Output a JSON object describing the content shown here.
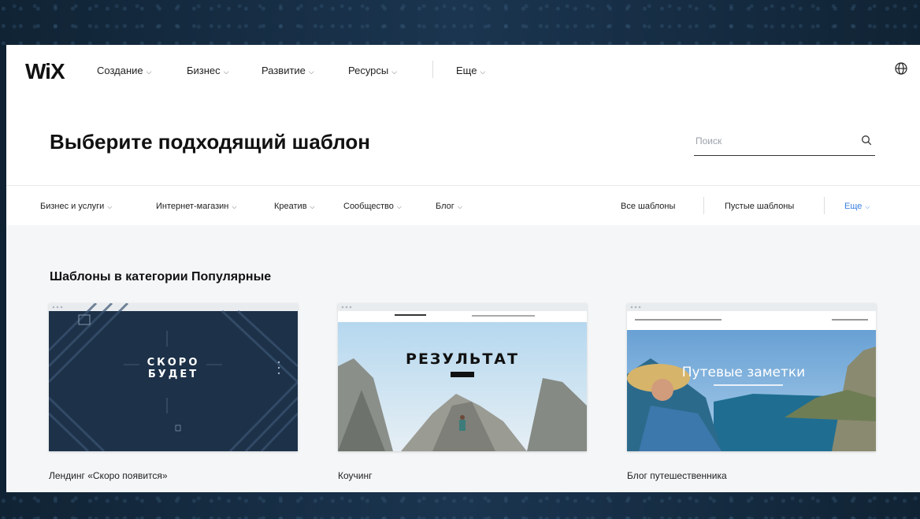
{
  "brand": {
    "logo": "WiX"
  },
  "topnav": {
    "items": [
      {
        "label": "Создание"
      },
      {
        "label": "Бизнес"
      },
      {
        "label": "Развитие"
      },
      {
        "label": "Ресурсы"
      },
      {
        "label": "Еще"
      }
    ],
    "globe_icon": "globe-icon"
  },
  "hero": {
    "title": "Выберите подходящий шаблон",
    "search_placeholder": "Поиск"
  },
  "categories": {
    "items": [
      {
        "label": "Бизнес и услуги"
      },
      {
        "label": "Интернет-магазин"
      },
      {
        "label": "Креатив"
      },
      {
        "label": "Сообщество"
      },
      {
        "label": "Блог"
      }
    ],
    "right": {
      "all": "Все шаблоны",
      "blank": "Пустые шаблоны",
      "more": "Еще"
    },
    "accent_color": "#3b7fe0"
  },
  "section": {
    "title": "Шаблоны в категории Популярные"
  },
  "cards": [
    {
      "title": "Лендинг «Скоро появится»",
      "preview_line1": "СКОРО",
      "preview_line2": "БУДЕТ"
    },
    {
      "title": "Коучинг",
      "preview_heading": "РЕЗУЛЬТАТ"
    },
    {
      "title": "Блог путешественника",
      "preview_heading": "Путевые заметки"
    }
  ]
}
